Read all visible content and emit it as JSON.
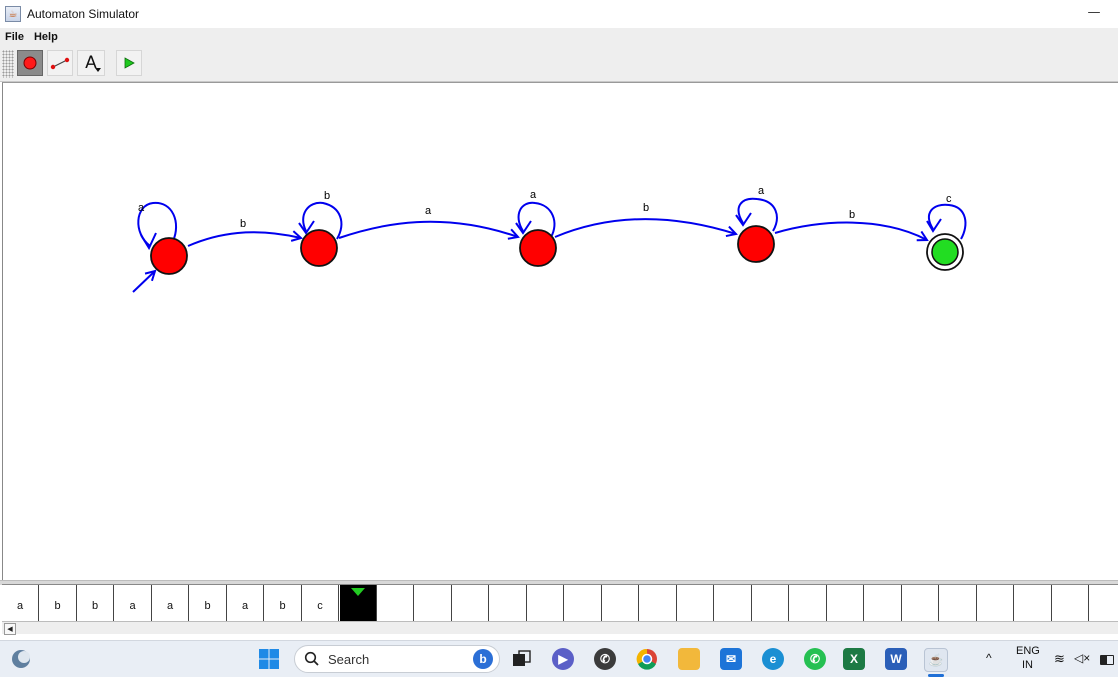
{
  "window": {
    "title": "Automaton Simulator",
    "minimize": "—"
  },
  "menu": [
    "File",
    "Help"
  ],
  "toolbar": {
    "tools": [
      {
        "name": "add-state-tool",
        "icon": "red-dot-icon",
        "selected": true
      },
      {
        "name": "add-transition-tool",
        "icon": "red-arrow-line-icon",
        "selected": false
      },
      {
        "name": "label-tool",
        "icon": "letter-a-icon",
        "label": "A",
        "selected": false
      },
      {
        "name": "run-tool",
        "icon": "green-play-icon",
        "selected": false
      }
    ]
  },
  "automaton": {
    "states": [
      {
        "id": "s0",
        "initial": true,
        "accepting": false,
        "color": "#ff0000"
      },
      {
        "id": "s1",
        "initial": false,
        "accepting": false,
        "color": "#ff0000"
      },
      {
        "id": "s2",
        "initial": false,
        "accepting": false,
        "color": "#ff0000"
      },
      {
        "id": "s3",
        "initial": false,
        "accepting": false,
        "color": "#ff0000"
      },
      {
        "id": "s4",
        "initial": false,
        "accepting": true,
        "color": "#22dd22"
      }
    ],
    "transitions": [
      {
        "from": "s0",
        "to": "s0",
        "label": "a"
      },
      {
        "from": "s0",
        "to": "s1",
        "label": "b"
      },
      {
        "from": "s1",
        "to": "s1",
        "label": "b"
      },
      {
        "from": "s1",
        "to": "s2",
        "label": "a"
      },
      {
        "from": "s2",
        "to": "s2",
        "label": "a"
      },
      {
        "from": "s2",
        "to": "s3",
        "label": "b"
      },
      {
        "from": "s3",
        "to": "s3",
        "label": "a"
      },
      {
        "from": "s3",
        "to": "s4",
        "label": "b"
      },
      {
        "from": "s4",
        "to": "s4",
        "label": "c"
      }
    ],
    "edge_color": "#0000ee"
  },
  "tape": {
    "cells": [
      "a",
      "b",
      "b",
      "a",
      "a",
      "b",
      "a",
      "b",
      "c"
    ],
    "head_index": 9,
    "total_cells": 30,
    "head_color": "#22cc22"
  },
  "taskbar": {
    "search_placeholder": "Search",
    "language": "ENG",
    "region": "IN",
    "apps": [
      "windows-start",
      "search",
      "bing",
      "task-view",
      "teams-meet",
      "whatsapp-alt",
      "chrome",
      "file-explorer",
      "mail",
      "edge",
      "whatsapp",
      "excel",
      "word",
      "java"
    ]
  }
}
